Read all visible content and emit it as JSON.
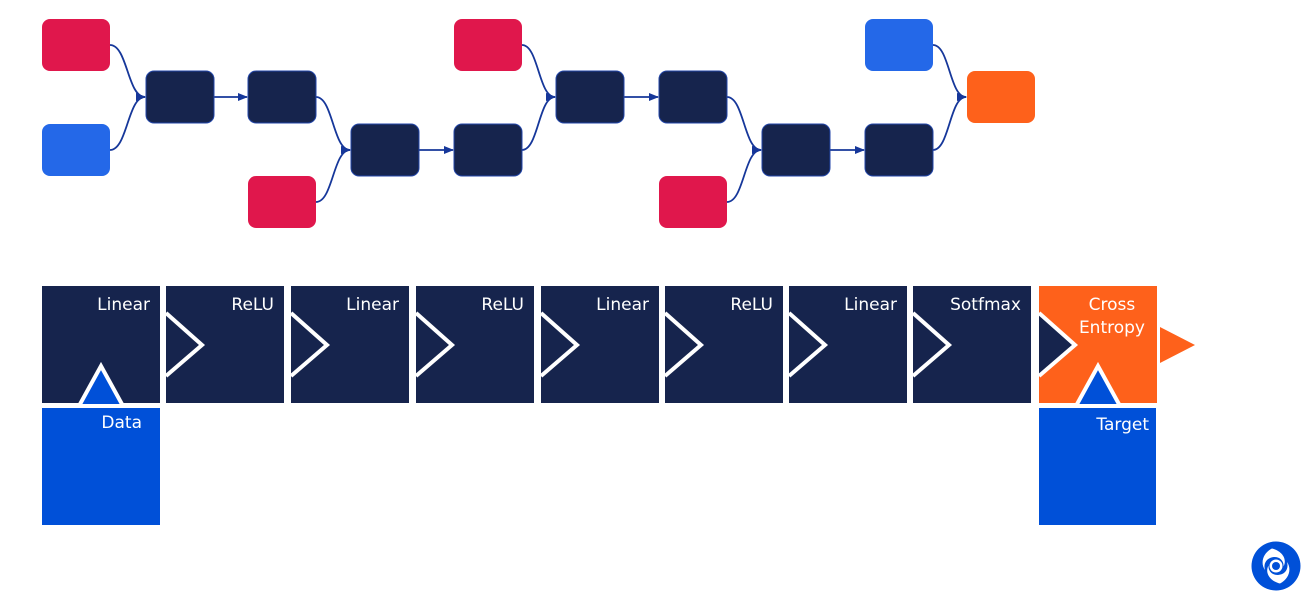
{
  "colors": {
    "dark": "#16244d",
    "red": "#e0174c",
    "blue_node": "#2468e8",
    "orange": "#fe611b",
    "input_blue": "#0050d8",
    "edge": "#16379a",
    "white": "#ffffff"
  },
  "graph": {
    "nodes": [
      {
        "id": "r1",
        "kind": "red"
      },
      {
        "id": "b1",
        "kind": "blue"
      },
      {
        "id": "d1",
        "kind": "dark"
      },
      {
        "id": "d2",
        "kind": "dark"
      },
      {
        "id": "r2",
        "kind": "red"
      },
      {
        "id": "d3",
        "kind": "dark"
      },
      {
        "id": "d4",
        "kind": "dark"
      },
      {
        "id": "r3",
        "kind": "red"
      },
      {
        "id": "d5",
        "kind": "dark"
      },
      {
        "id": "d6",
        "kind": "dark"
      },
      {
        "id": "r4",
        "kind": "red"
      },
      {
        "id": "d7",
        "kind": "dark"
      },
      {
        "id": "d8",
        "kind": "dark"
      },
      {
        "id": "b2",
        "kind": "blue"
      },
      {
        "id": "o1",
        "kind": "orange"
      }
    ],
    "edges": [
      [
        "r1",
        "d1"
      ],
      [
        "b1",
        "d1"
      ],
      [
        "d1",
        "d2"
      ],
      [
        "d2",
        "d3"
      ],
      [
        "r2",
        "d3"
      ],
      [
        "d3",
        "d4"
      ],
      [
        "d4",
        "d5"
      ],
      [
        "r3",
        "d5"
      ],
      [
        "d5",
        "d6"
      ],
      [
        "d6",
        "d7"
      ],
      [
        "r4",
        "d7"
      ],
      [
        "d7",
        "d8"
      ],
      [
        "d8",
        "o1"
      ],
      [
        "b2",
        "o1"
      ]
    ]
  },
  "pipeline": {
    "layers": [
      {
        "label": "Linear",
        "style": "dark"
      },
      {
        "label": "ReLU",
        "style": "dark"
      },
      {
        "label": "Linear",
        "style": "dark"
      },
      {
        "label": "ReLU",
        "style": "dark"
      },
      {
        "label": "Linear",
        "style": "dark"
      },
      {
        "label": "ReLU",
        "style": "dark"
      },
      {
        "label": "Linear",
        "style": "dark"
      },
      {
        "label": "Sotfmax",
        "style": "dark"
      },
      {
        "label": "Cross\nEntropy",
        "style": "orange"
      }
    ],
    "inputs": {
      "data": {
        "label": "Data"
      },
      "target": {
        "label": "Target"
      }
    }
  },
  "logo": {
    "name": "deepmind-logo"
  }
}
